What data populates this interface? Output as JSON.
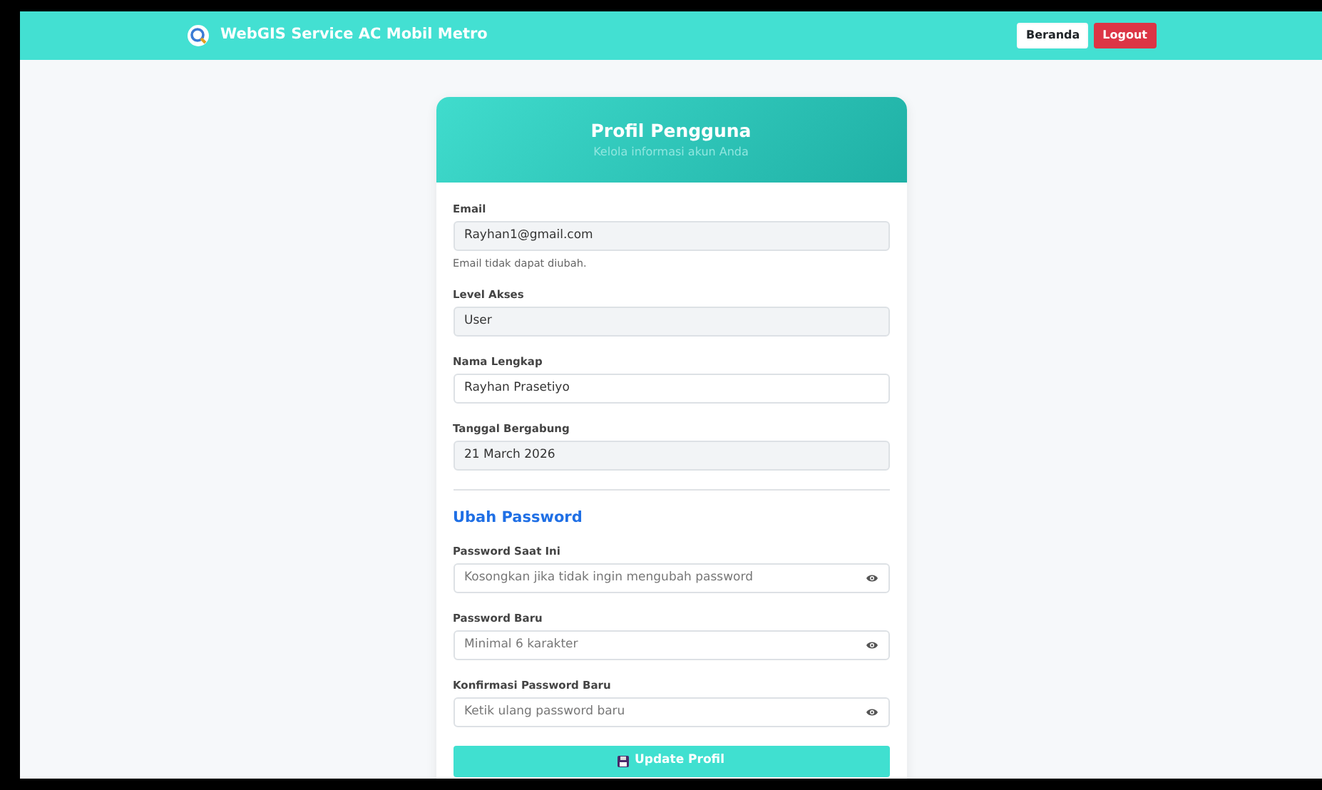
{
  "navbar": {
    "brand": "WebGIS Service AC Mobil Metro",
    "buttons": [
      {
        "label": "Beranda",
        "kind": "light"
      },
      {
        "label": "Logout",
        "kind": "danger"
      }
    ]
  },
  "card": {
    "title": "Profil Pengguna",
    "subtitle": "Kelola informasi akun Anda"
  },
  "profile_fields": [
    {
      "label": "Email",
      "value": "Rayhan1@gmail.com",
      "disabled": true,
      "help": "Email tidak dapat diubah."
    },
    {
      "label": "Level Akses",
      "value": "User",
      "disabled": true
    },
    {
      "label": "Nama Lengkap",
      "value": "Rayhan Prasetiyo",
      "disabled": false
    },
    {
      "label": "Tanggal Bergabung",
      "value": "21 March 2026",
      "disabled": true
    }
  ],
  "password_section": {
    "heading": "Ubah Password",
    "fields": [
      {
        "label": "Password Saat Ini",
        "placeholder": "Kosongkan jika tidak ingin mengubah password"
      },
      {
        "label": "Password Baru",
        "placeholder": "Minimal 6 karakter"
      },
      {
        "label": "Konfirmasi Password Baru",
        "placeholder": "Ketik ulang password baru"
      }
    ]
  },
  "submit_button": {
    "label": "Update Profil"
  }
}
